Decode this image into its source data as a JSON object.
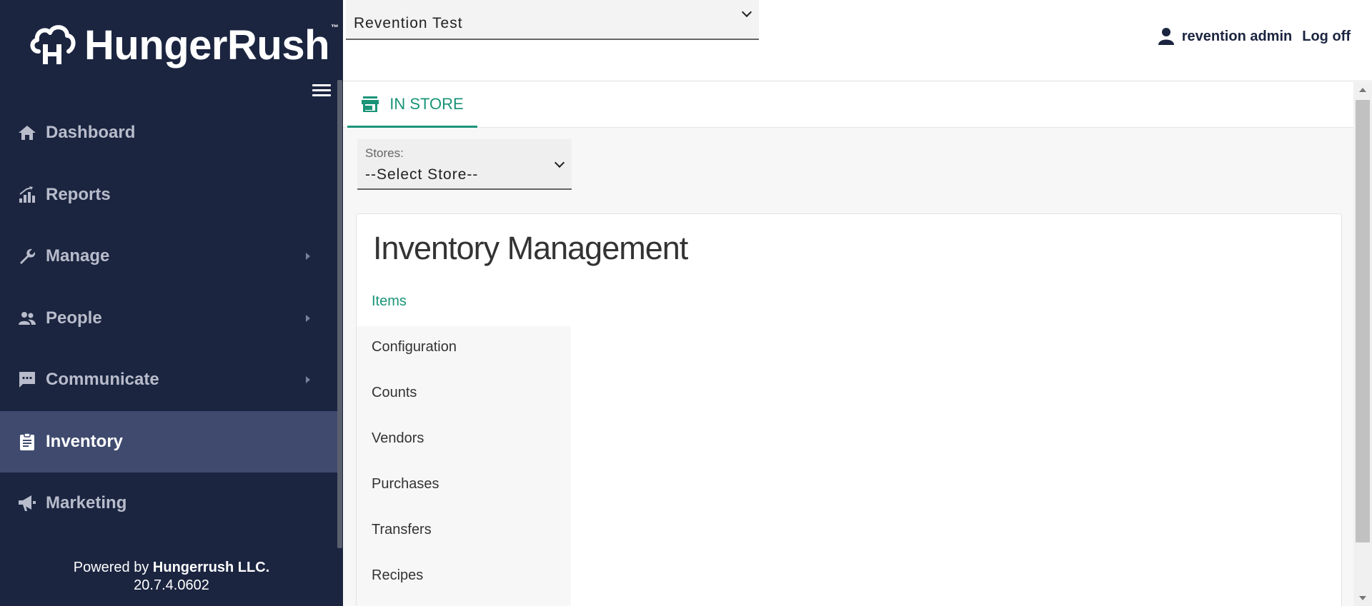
{
  "brand": {
    "name": "HungerRush",
    "tm": "™",
    "icon": "hungerrush-logo-icon"
  },
  "sidebar": {
    "menu_icon": "hamburger-icon",
    "items": [
      {
        "label": "Dashboard",
        "icon": "home-icon",
        "has_submenu": false,
        "active": false
      },
      {
        "label": "Reports",
        "icon": "bar-chart-icon",
        "has_submenu": false,
        "active": false
      },
      {
        "label": "Manage",
        "icon": "wrench-icon",
        "has_submenu": true,
        "active": false
      },
      {
        "label": "People",
        "icon": "people-icon",
        "has_submenu": true,
        "active": false
      },
      {
        "label": "Communicate",
        "icon": "chat-icon",
        "has_submenu": true,
        "active": false
      },
      {
        "label": "Inventory",
        "icon": "clipboard-icon",
        "has_submenu": false,
        "active": true
      },
      {
        "label": "Marketing",
        "icon": "megaphone-icon",
        "has_submenu": false,
        "active": false
      }
    ],
    "footer": {
      "prefix": "Powered by ",
      "company": "Hungerrush LLC.",
      "version": "20.7.4.0602"
    }
  },
  "header": {
    "org_select_value": "Revention Test",
    "user_name": "revention admin",
    "user_icon": "person-icon",
    "logoff_label": "Log off"
  },
  "tabs": [
    {
      "label": "IN STORE",
      "icon": "store-icon",
      "active": true
    }
  ],
  "store_filter": {
    "label": "Stores:",
    "value": "--Select Store--"
  },
  "inventory": {
    "title": "Inventory Management",
    "menu": [
      "Items",
      "Configuration",
      "Counts",
      "Vendors",
      "Purchases",
      "Transfers",
      "Recipes"
    ],
    "active_menu": "Items"
  },
  "colors": {
    "sidebar_bg": "#1b2540",
    "sidebar_active": "#3f4a6e",
    "accent": "#1a9478"
  }
}
